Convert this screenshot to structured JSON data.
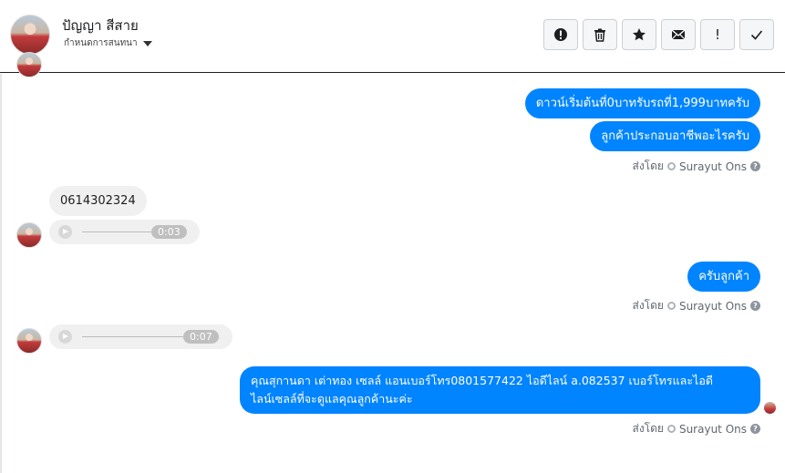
{
  "header": {
    "contact_name": "ปัญญา สีสาย",
    "status_label": "กำหนดการสนทนา"
  },
  "toolbar": {
    "buttons": [
      "alert-circle-icon",
      "trash-icon",
      "star-icon",
      "envelope-icon",
      "exclamation-icon",
      "check-icon"
    ],
    "exclamation_glyph": "!"
  },
  "messages": {
    "out_1": "ดาวน์เริ่มต้นที่0บาทรับรถที่1,999บาทครับ",
    "out_2": "ลูกค้าประกอบอาชีพอะไรครับ",
    "sent_1_prefix": "ส่งโดย",
    "sent_1_agent": "Surayut Ons",
    "in_1": "0614302324",
    "audio_1_duration": "0:03",
    "out_3": "ครับลูกค้า",
    "sent_2_prefix": "ส่งโดย",
    "sent_2_agent": "Surayut Ons",
    "audio_2_duration": "0:07",
    "out_4_line1": "คุณสุกานดา เต่าทอง  เซลล์ แอนเบอร์โทร0801577422 ไอดีไลน์ a.082537  เบอร์โทรและไอดี",
    "out_4_line2": "ไลน์เซลล์ที่จะดูแลคุณลูกค้านะค่ะ",
    "sent_3_prefix": "ส่งโดย",
    "sent_3_agent": "Surayut Ons",
    "help_glyph": "?"
  },
  "colors": {
    "outgoing_bubble": "#0084ff",
    "incoming_bubble": "#f1f0f0"
  }
}
